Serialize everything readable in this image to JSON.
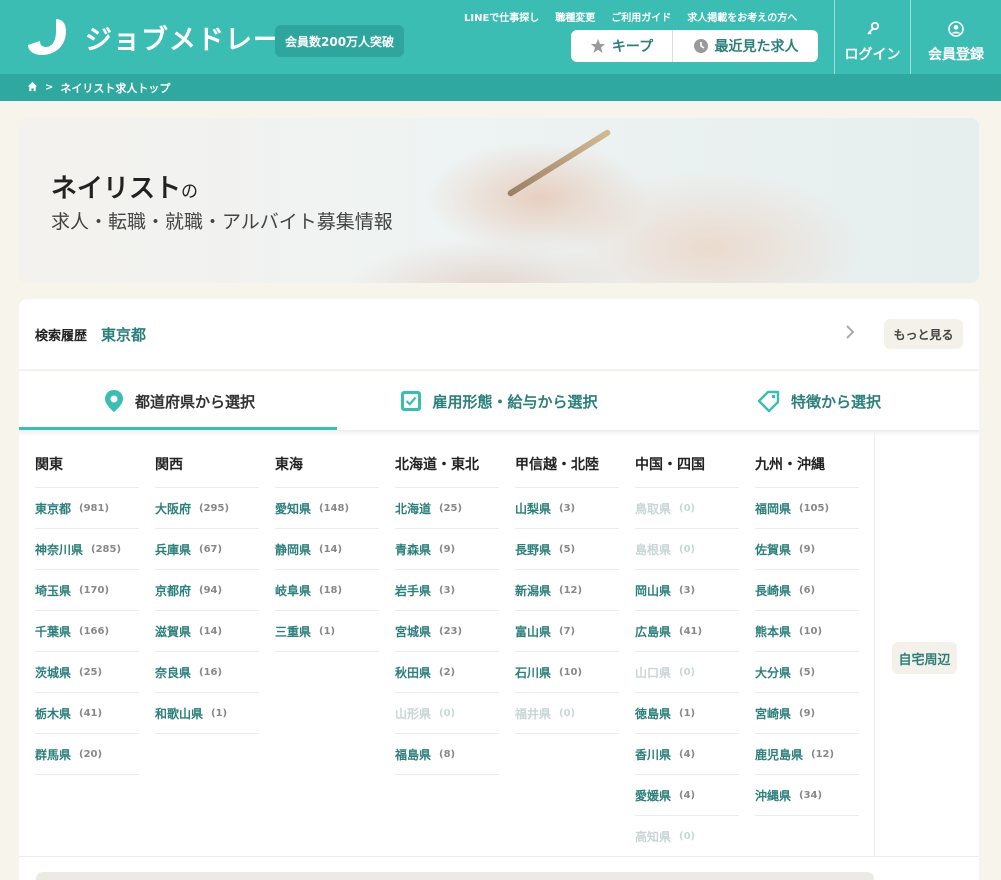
{
  "header": {
    "brand": "ジョブメドレー",
    "member_badge": "会員数200万人突破",
    "top_links": [
      "LINEで仕事探し",
      "職種変更",
      "ご利用ガイド",
      "求人掲載をお考えの方へ"
    ],
    "keep_label": "キープ",
    "recent_label": "最近見た求人",
    "login_label": "ログイン",
    "register_label": "会員登録"
  },
  "breadcrumb": {
    "current": "ネイリスト求人トップ"
  },
  "hero": {
    "title": "ネイリスト",
    "title_suffix": "の",
    "subtitle": "求人・転職・就職・アルバイト募集情報"
  },
  "history": {
    "label": "検索履歴",
    "value": "東京都",
    "more_label": "もっと見る"
  },
  "tabs": [
    {
      "label": "都道府県から選択",
      "icon": "location-pin-icon",
      "active": true
    },
    {
      "label": "雇用形態・給与から選択",
      "icon": "checkbox-icon",
      "active": false
    },
    {
      "label": "特徴から選択",
      "icon": "tag-icon",
      "active": false
    }
  ],
  "regions": [
    {
      "name": "関東",
      "prefs": [
        {
          "name": "東京都",
          "count": "(981)",
          "enabled": true
        },
        {
          "name": "神奈川県",
          "count": "(285)",
          "enabled": true
        },
        {
          "name": "埼玉県",
          "count": "(170)",
          "enabled": true
        },
        {
          "name": "千葉県",
          "count": "(166)",
          "enabled": true
        },
        {
          "name": "茨城県",
          "count": "(25)",
          "enabled": true
        },
        {
          "name": "栃木県",
          "count": "(41)",
          "enabled": true
        },
        {
          "name": "群馬県",
          "count": "(20)",
          "enabled": true
        }
      ]
    },
    {
      "name": "関西",
      "prefs": [
        {
          "name": "大阪府",
          "count": "(295)",
          "enabled": true
        },
        {
          "name": "兵庫県",
          "count": "(67)",
          "enabled": true
        },
        {
          "name": "京都府",
          "count": "(94)",
          "enabled": true
        },
        {
          "name": "滋賀県",
          "count": "(14)",
          "enabled": true
        },
        {
          "name": "奈良県",
          "count": "(16)",
          "enabled": true
        },
        {
          "name": "和歌山県",
          "count": "(1)",
          "enabled": true
        }
      ]
    },
    {
      "name": "東海",
      "prefs": [
        {
          "name": "愛知県",
          "count": "(148)",
          "enabled": true
        },
        {
          "name": "静岡県",
          "count": "(14)",
          "enabled": true
        },
        {
          "name": "岐阜県",
          "count": "(18)",
          "enabled": true
        },
        {
          "name": "三重県",
          "count": "(1)",
          "enabled": true
        }
      ]
    },
    {
      "name": "北海道・東北",
      "prefs": [
        {
          "name": "北海道",
          "count": "(25)",
          "enabled": true
        },
        {
          "name": "青森県",
          "count": "(9)",
          "enabled": true
        },
        {
          "name": "岩手県",
          "count": "(3)",
          "enabled": true
        },
        {
          "name": "宮城県",
          "count": "(23)",
          "enabled": true
        },
        {
          "name": "秋田県",
          "count": "(2)",
          "enabled": true
        },
        {
          "name": "山形県",
          "count": "(0)",
          "enabled": false
        },
        {
          "name": "福島県",
          "count": "(8)",
          "enabled": true
        }
      ]
    },
    {
      "name": "甲信越・北陸",
      "prefs": [
        {
          "name": "山梨県",
          "count": "(3)",
          "enabled": true
        },
        {
          "name": "長野県",
          "count": "(5)",
          "enabled": true
        },
        {
          "name": "新潟県",
          "count": "(12)",
          "enabled": true
        },
        {
          "name": "富山県",
          "count": "(7)",
          "enabled": true
        },
        {
          "name": "石川県",
          "count": "(10)",
          "enabled": true
        },
        {
          "name": "福井県",
          "count": "(0)",
          "enabled": false
        }
      ]
    },
    {
      "name": "中国・四国",
      "prefs": [
        {
          "name": "鳥取県",
          "count": "(0)",
          "enabled": false
        },
        {
          "name": "島根県",
          "count": "(0)",
          "enabled": false
        },
        {
          "name": "岡山県",
          "count": "(3)",
          "enabled": true
        },
        {
          "name": "広島県",
          "count": "(41)",
          "enabled": true
        },
        {
          "name": "山口県",
          "count": "(0)",
          "enabled": false
        },
        {
          "name": "徳島県",
          "count": "(1)",
          "enabled": true
        },
        {
          "name": "香川県",
          "count": "(4)",
          "enabled": true
        },
        {
          "name": "愛媛県",
          "count": "(4)",
          "enabled": true
        },
        {
          "name": "高知県",
          "count": "(0)",
          "enabled": false
        }
      ]
    },
    {
      "name": "九州・沖縄",
      "prefs": [
        {
          "name": "福岡県",
          "count": "(105)",
          "enabled": true
        },
        {
          "name": "佐賀県",
          "count": "(9)",
          "enabled": true
        },
        {
          "name": "長崎県",
          "count": "(6)",
          "enabled": true
        },
        {
          "name": "熊本県",
          "count": "(10)",
          "enabled": true
        },
        {
          "name": "大分県",
          "count": "(5)",
          "enabled": true
        },
        {
          "name": "宮崎県",
          "count": "(9)",
          "enabled": true
        },
        {
          "name": "鹿児島県",
          "count": "(12)",
          "enabled": true
        },
        {
          "name": "沖縄県",
          "count": "(34)",
          "enabled": true
        }
      ]
    }
  ],
  "nearby_label": "自宅周辺",
  "colors": {
    "brand": "#3bbdb4",
    "brand_dark": "#2fa8a0",
    "link": "#2c7f7a",
    "disabled": "#c9d6d6"
  }
}
